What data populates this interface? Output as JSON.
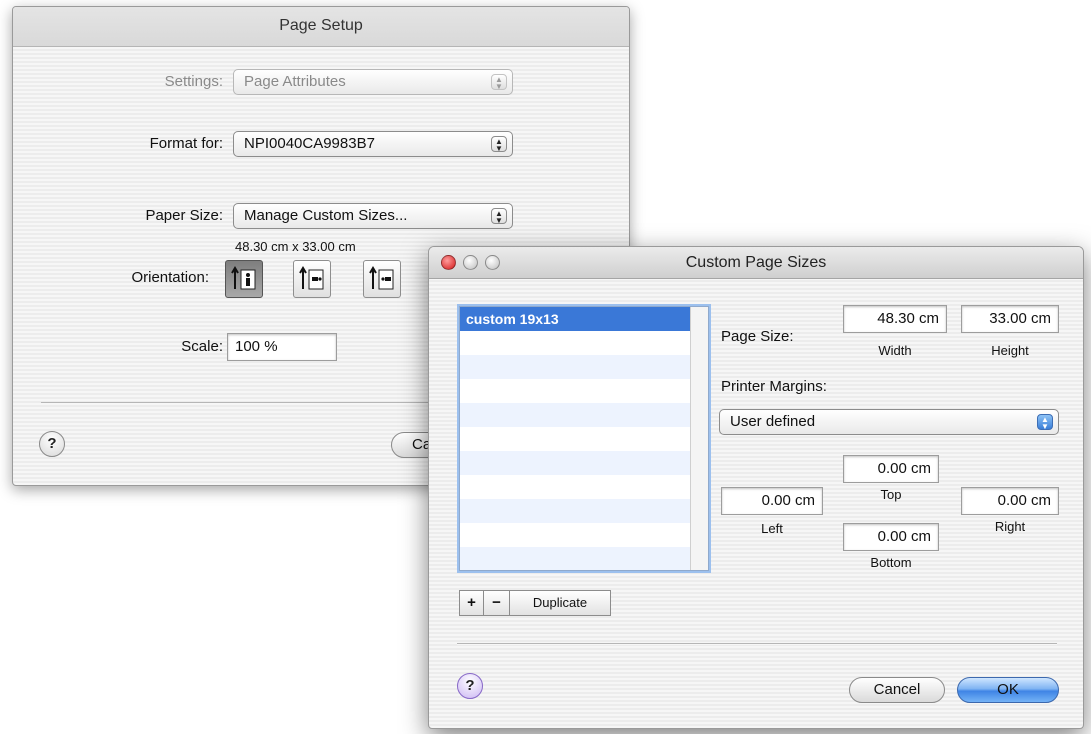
{
  "page_setup": {
    "title": "Page Setup",
    "settings_label": "Settings:",
    "settings_value": "Page Attributes",
    "format_label": "Format for:",
    "format_value": "NPI0040CA9983B7",
    "paper_label": "Paper Size:",
    "paper_value": "Manage Custom Sizes...",
    "paper_dims": "48.30 cm x 33.00 cm",
    "orientation_label": "Orientation:",
    "scale_label": "Scale:",
    "scale_value": "100 %",
    "help": "?",
    "cancel_label": "Ca"
  },
  "custom": {
    "title": "Custom Page Sizes",
    "list": {
      "items": [
        "custom 19x13"
      ],
      "selected": 0
    },
    "add": "+",
    "remove": "−",
    "duplicate": "Duplicate",
    "page_size_label": "Page Size:",
    "width_value": "48.30 cm",
    "height_value": "33.00 cm",
    "width_caption": "Width",
    "height_caption": "Height",
    "margins_label": "Printer Margins:",
    "margins_value": "User defined",
    "top_value": "0.00 cm",
    "left_value": "0.00 cm",
    "right_value": "0.00 cm",
    "bottom_value": "0.00 cm",
    "top_caption": "Top",
    "left_caption": "Left",
    "right_caption": "Right",
    "bottom_caption": "Bottom",
    "help": "?",
    "cancel": "Cancel",
    "ok": "OK"
  }
}
